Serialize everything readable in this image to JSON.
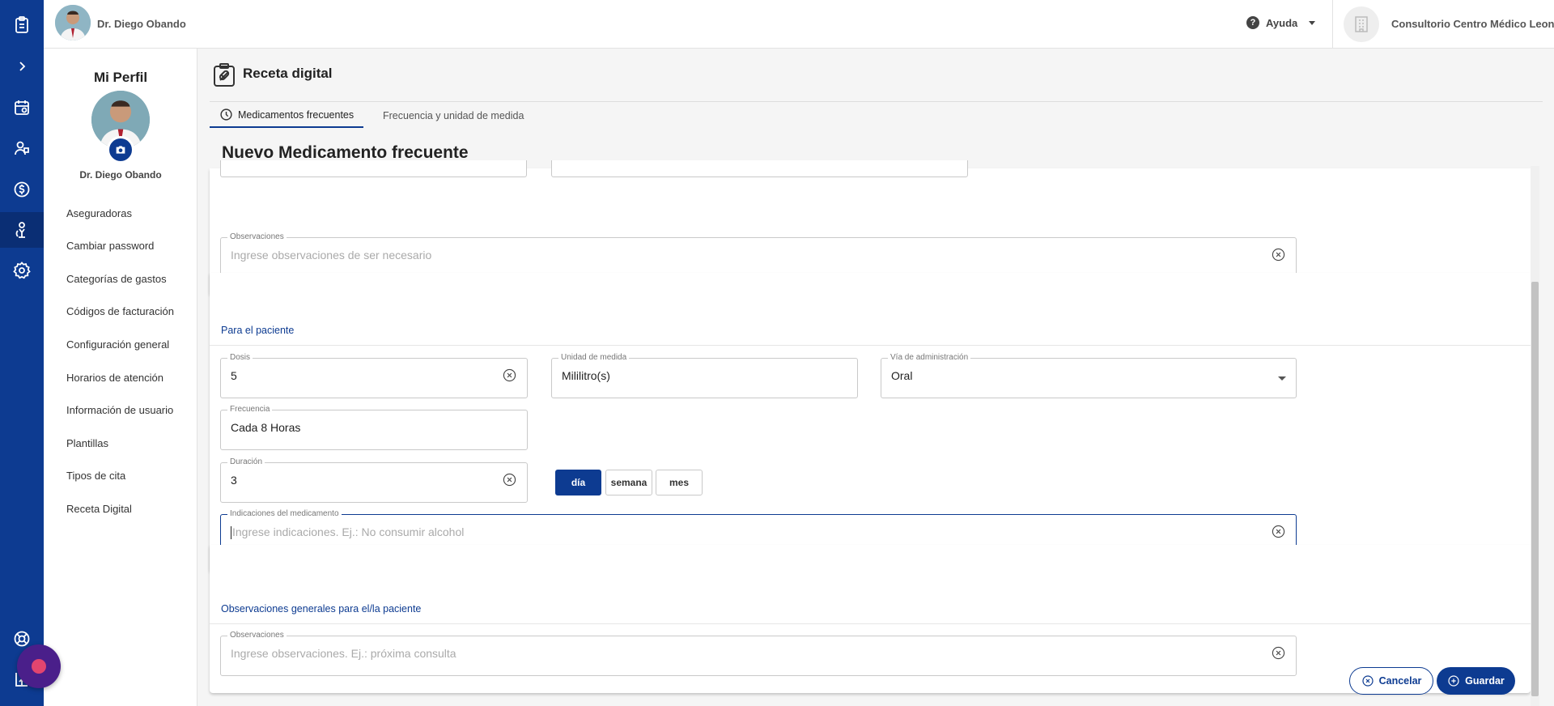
{
  "topbar": {
    "doctor_name": "Dr. Diego Obando",
    "help_label": "Ayuda",
    "clinic_name": "Consultorio Centro Médico Leon"
  },
  "rail": {
    "icons": [
      "clipboard-icon",
      "chevron-right-icon",
      "calendar-icon",
      "patients-icon",
      "billing-icon",
      "doctor-icon",
      "settings-icon",
      "support-icon",
      "logout-icon"
    ],
    "accent": "#0d3b91"
  },
  "profile": {
    "title": "Mi Perfil",
    "name": "Dr. Diego Obando",
    "menu": [
      "Aseguradoras",
      "Cambiar password",
      "Categorías de gastos",
      "Códigos de facturación",
      "Configuración general",
      "Horarios de atención",
      "Información de usuario",
      "Plantillas",
      "Tipos de cita",
      "Receta Digital"
    ]
  },
  "main": {
    "title": "Receta digital",
    "tabs": [
      {
        "label": "Medicamentos frecuentes",
        "active": true
      },
      {
        "label": "Frecuencia y unidad de medida",
        "active": false
      }
    ],
    "section_title": "Nuevo Medicamento frecuente",
    "observaciones_top": {
      "label": "Observaciones",
      "placeholder": "Ingrese observaciones de ser necesario"
    },
    "patient": {
      "heading": "Para el paciente",
      "dosis": {
        "label": "Dosis",
        "value": "5"
      },
      "unidad": {
        "label": "Unidad de medida",
        "value": "Mililitro(s)"
      },
      "via": {
        "label": "Vía de administración",
        "value": "Oral"
      },
      "frecuencia": {
        "label": "Frecuencia",
        "value": "Cada 8 Horas"
      },
      "duracion": {
        "label": "Duración",
        "value": "3"
      },
      "duration_units": [
        "día",
        "semana",
        "mes"
      ],
      "duration_selected": "día",
      "indicaciones": {
        "label": "Indicaciones del medicamento",
        "placeholder": "Ingrese indicaciones. Ej.: No consumir alcohol"
      }
    },
    "general": {
      "heading": "Observaciones generales para el/la paciente",
      "observaciones": {
        "label": "Observaciones",
        "placeholder": "Ingrese observaciones. Ej.: próxima consulta"
      }
    },
    "actions": {
      "cancel": "Cancelar",
      "save": "Guardar"
    }
  }
}
